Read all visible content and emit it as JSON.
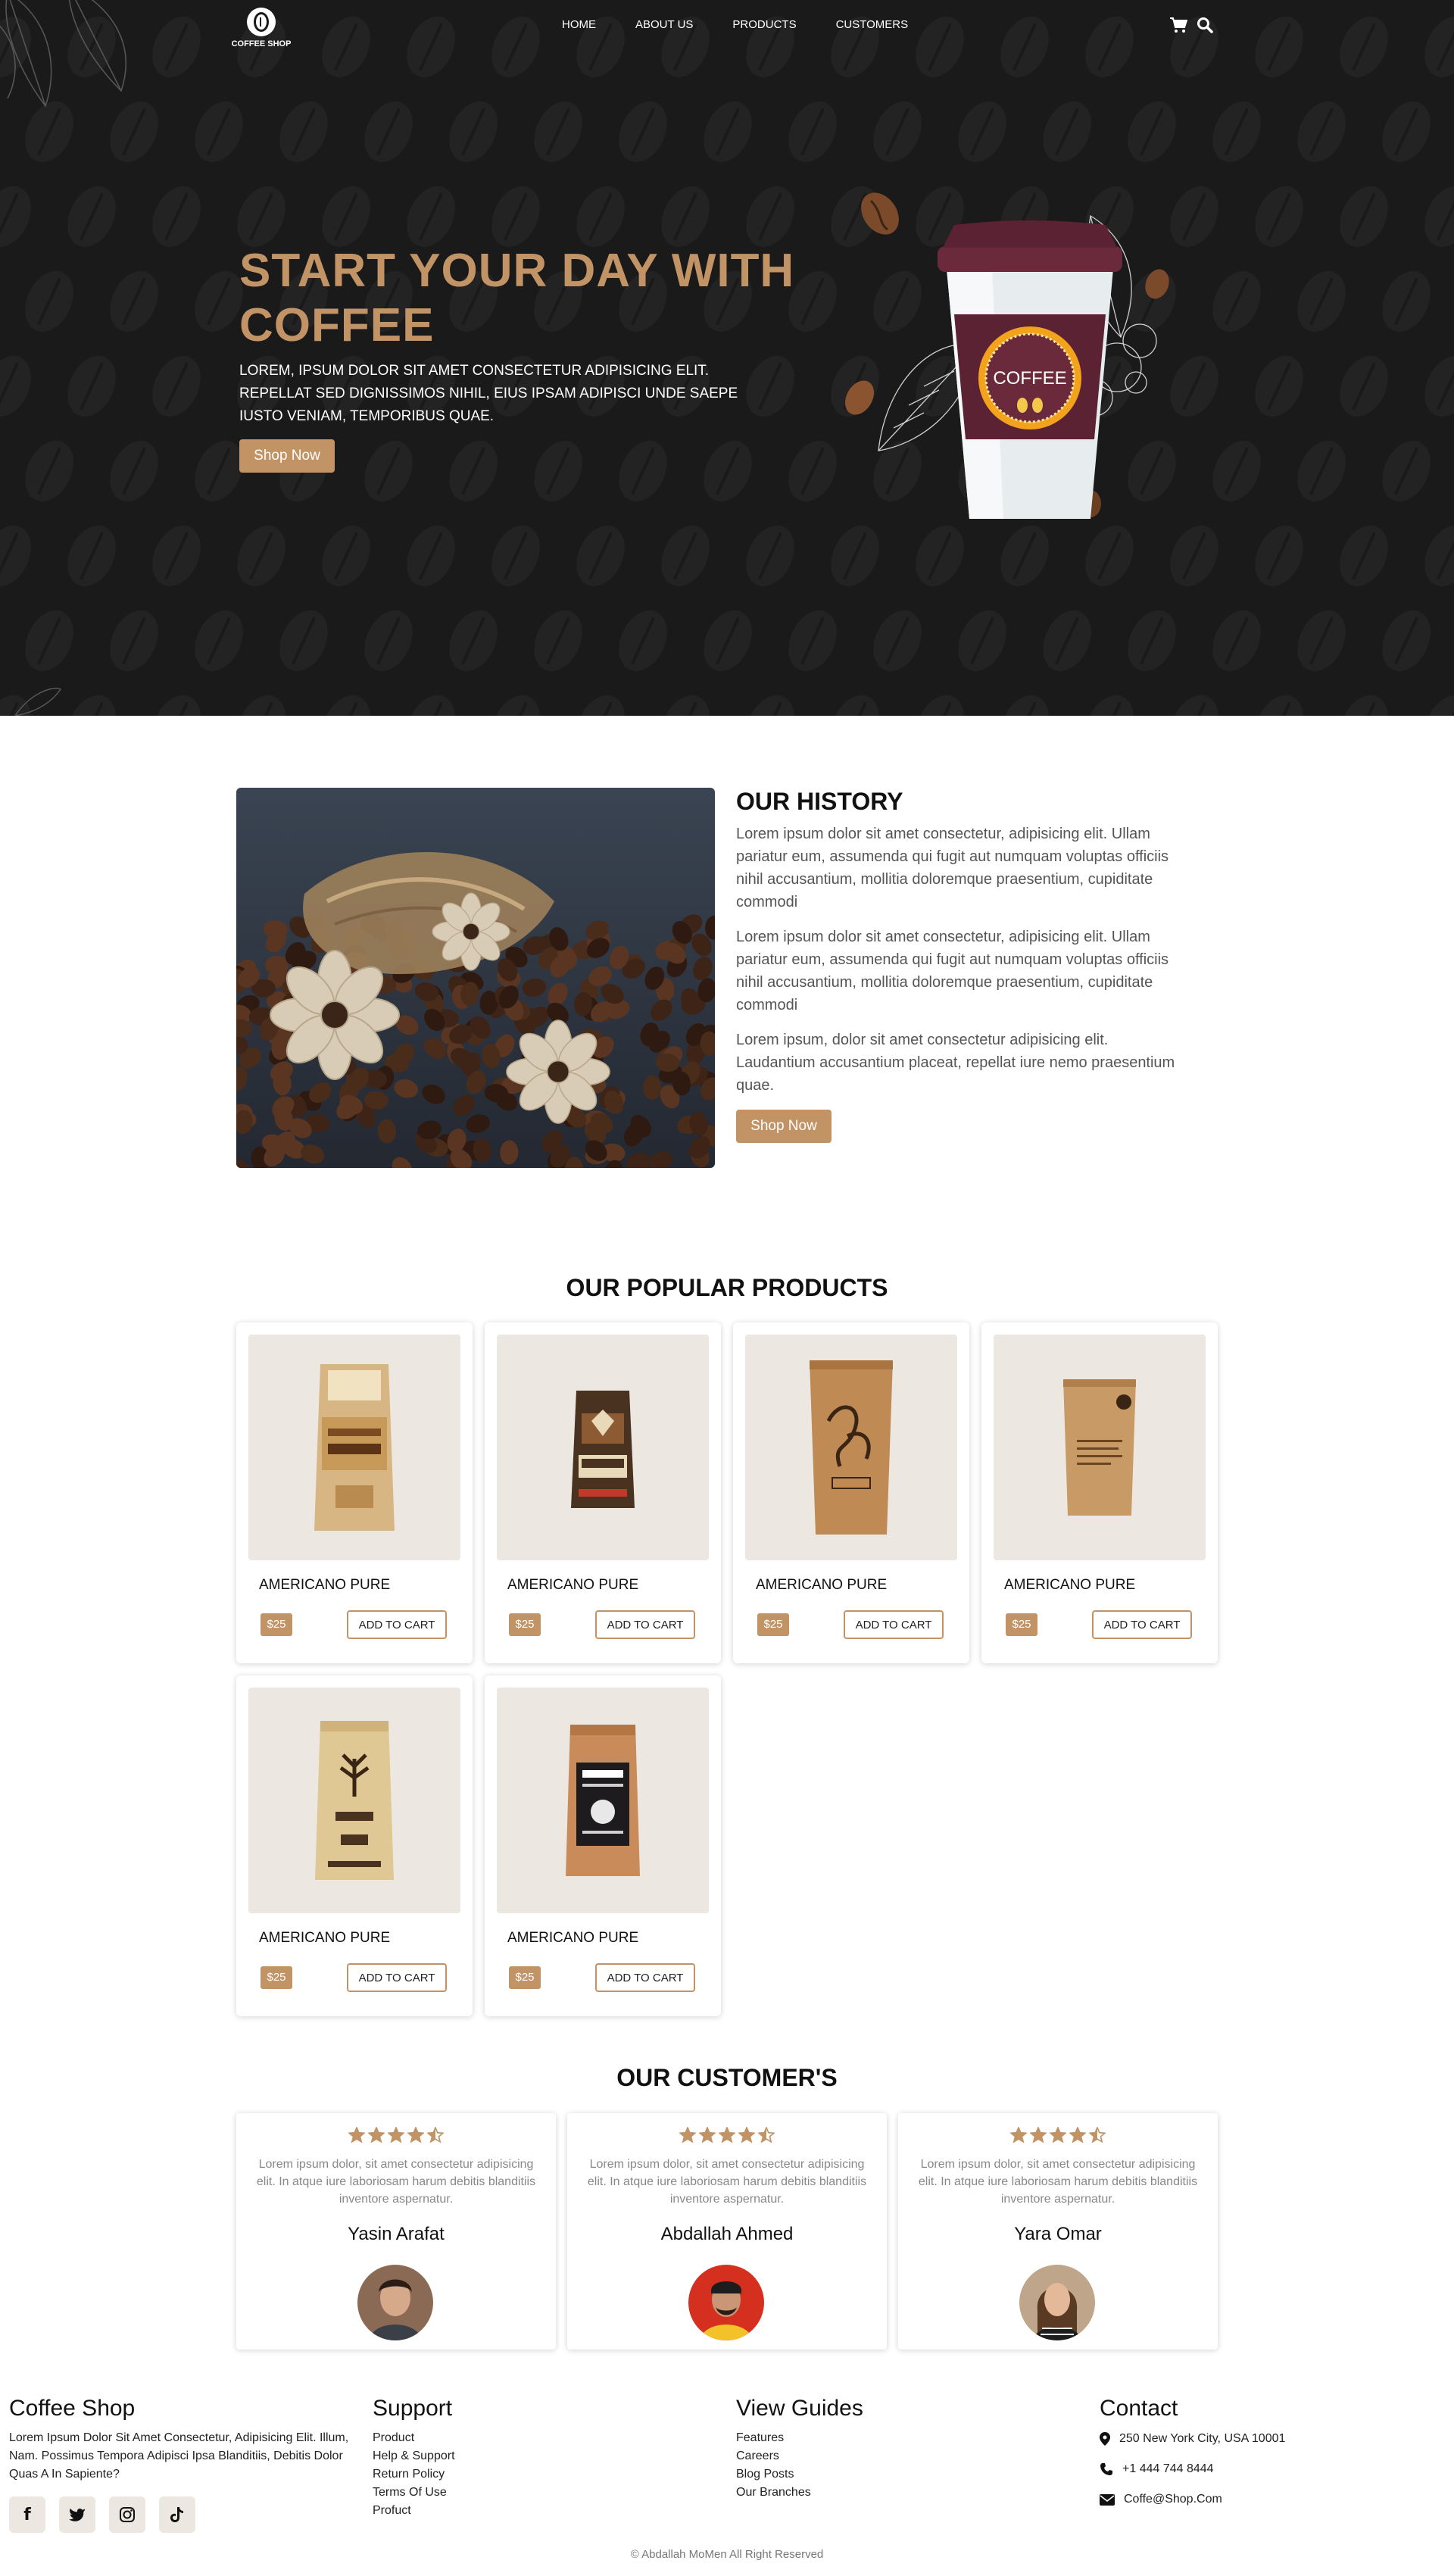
{
  "brand": {
    "name": "COFFEE SHOP"
  },
  "nav": {
    "items": [
      "HOME",
      "ABOUT US",
      "PRODUCTS",
      "CUSTOMERS"
    ]
  },
  "hero": {
    "title": "START YOUR DAY WITH COFFEE",
    "description": "LOREM, IPSUM DOLOR SIT AMET CONSECTETUR ADIPISICING ELIT. REPELLAT SED DIGNISSIMOS NIHIL, EIUS IPSAM ADIPISCI UNDE SAEPE IUSTO VENIAM, TEMPORIBUS QUAE.",
    "button": "Shop Now",
    "cup_label": "COFFEE"
  },
  "history": {
    "title": "OUR HISTORY",
    "paragraphs": [
      "Lorem ipsum dolor sit amet consectetur, adipisicing elit. Ullam pariatur eum, assumenda qui fugit aut numquam voluptas officiis nihil accusantium, mollitia doloremque praesentium, cupiditate commodi",
      "Lorem ipsum dolor sit amet consectetur, adipisicing elit. Ullam pariatur eum, assumenda qui fugit aut numquam voluptas officiis nihil accusantium, mollitia doloremque praesentium, cupiditate commodi",
      "Lorem ipsum, dolor sit amet consectetur adipisicing elit. Laudantium accusantium placeat, repellat iure nemo praesentium quae."
    ],
    "button": "Shop Now"
  },
  "products": {
    "title": "OUR POPULAR PRODUCTS",
    "items": [
      {
        "name": "AMERICANO PURE",
        "price": "$25",
        "button": "ADD TO CART"
      },
      {
        "name": "AMERICANO PURE",
        "price": "$25",
        "button": "ADD TO CART"
      },
      {
        "name": "AMERICANO PURE",
        "price": "$25",
        "button": "ADD TO CART"
      },
      {
        "name": "AMERICANO PURE",
        "price": "$25",
        "button": "ADD TO CART"
      },
      {
        "name": "AMERICANO PURE",
        "price": "$25",
        "button": "ADD TO CART"
      },
      {
        "name": "AMERICANO PURE",
        "price": "$25",
        "button": "ADD TO CART"
      }
    ]
  },
  "customers": {
    "title": "OUR CUSTOMER'S",
    "rating": 4.5,
    "reviews": [
      {
        "text": "Lorem ipsum dolor, sit amet consectetur adipisicing elit. In atque iure laboriosam harum debitis blanditiis inventore aspernatur.",
        "name": "Yasin Arafat"
      },
      {
        "text": "Lorem ipsum dolor, sit amet consectetur adipisicing elit. In atque iure laboriosam harum debitis blanditiis inventore aspernatur.",
        "name": "Abdallah Ahmed"
      },
      {
        "text": "Lorem ipsum dolor, sit amet consectetur adipisicing elit. In atque iure laboriosam harum debitis blanditiis inventore aspernatur.",
        "name": "Yara Omar"
      }
    ]
  },
  "footer": {
    "about": {
      "title": "Coffee Shop",
      "text": "Lorem Ipsum Dolor Sit Amet Consectetur, Adipisicing Elit. Illum, Nam. Possimus Tempora Adipisci Ipsa Blanditiis, Debitis Dolor Quas A In Sapiente?"
    },
    "support": {
      "title": "Support",
      "links": [
        "Product",
        "Help & Support",
        "Return Policy",
        "Terms Of Use",
        "Profuct"
      ]
    },
    "guides": {
      "title": "View Guides",
      "links": [
        "Features",
        "Careers",
        "Blog Posts",
        "Our Branches"
      ]
    },
    "contact": {
      "title": "Contact",
      "address": "250 New York City, USA 10001",
      "phone": "+1 444 744 8444",
      "email": "Coffe@Shop.Com"
    },
    "social_icons": [
      "facebook-icon",
      "twitter-icon",
      "instagram-icon",
      "tiktok-icon"
    ],
    "copyright": "© Abdallah MoMen All Right Reserved"
  },
  "colors": {
    "accent": "#c19365",
    "hero_bg": "#1b1a1a",
    "card_img_bg": "#ece8e1"
  }
}
